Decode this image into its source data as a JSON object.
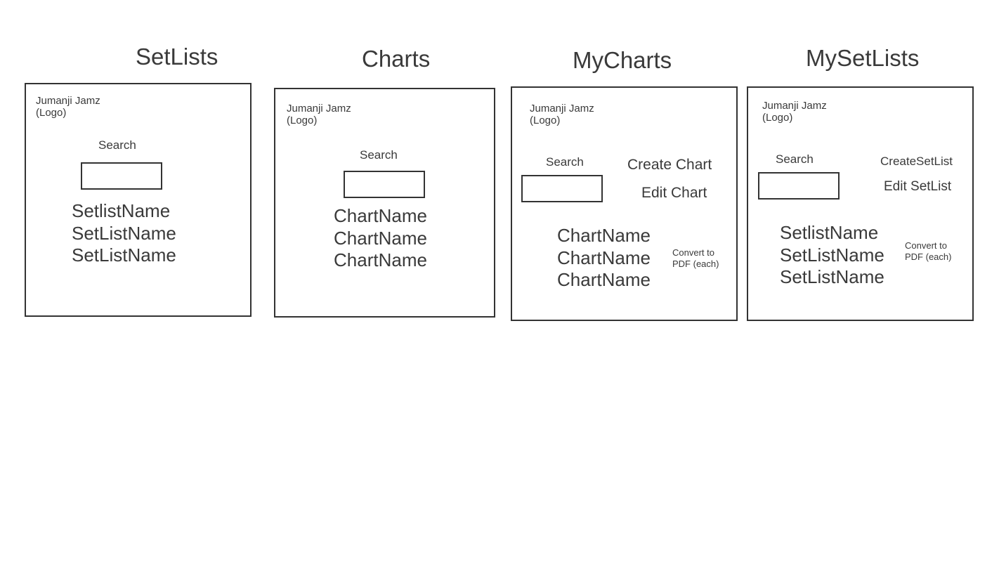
{
  "wireframes": [
    {
      "title": "SetLists",
      "logo": "Jumanji Jamz\n(Logo)",
      "search_label": "Search",
      "items": [
        "SetlistName",
        "SetListName",
        "SetListName"
      ]
    },
    {
      "title": "Charts",
      "logo": "Jumanji Jamz\n(Logo)",
      "search_label": "Search",
      "items": [
        "ChartName",
        "ChartName",
        "ChartName"
      ]
    },
    {
      "title": "MyCharts",
      "logo": "Jumanji Jamz\n(Logo)",
      "search_label": "Search",
      "create_label": "Create Chart",
      "edit_label": "Edit Chart",
      "items": [
        "ChartName",
        "ChartName",
        "ChartName"
      ],
      "pdf_label": "Convert to\nPDF (each)"
    },
    {
      "title": "MySetLists",
      "logo": "Jumanji Jamz\n(Logo)",
      "search_label": "Search",
      "create_label": "CreateSetList",
      "edit_label": "Edit SetList",
      "items": [
        "SetlistName",
        "SetListName",
        "SetListName"
      ],
      "pdf_label": "Convert to\nPDF (each)"
    }
  ]
}
